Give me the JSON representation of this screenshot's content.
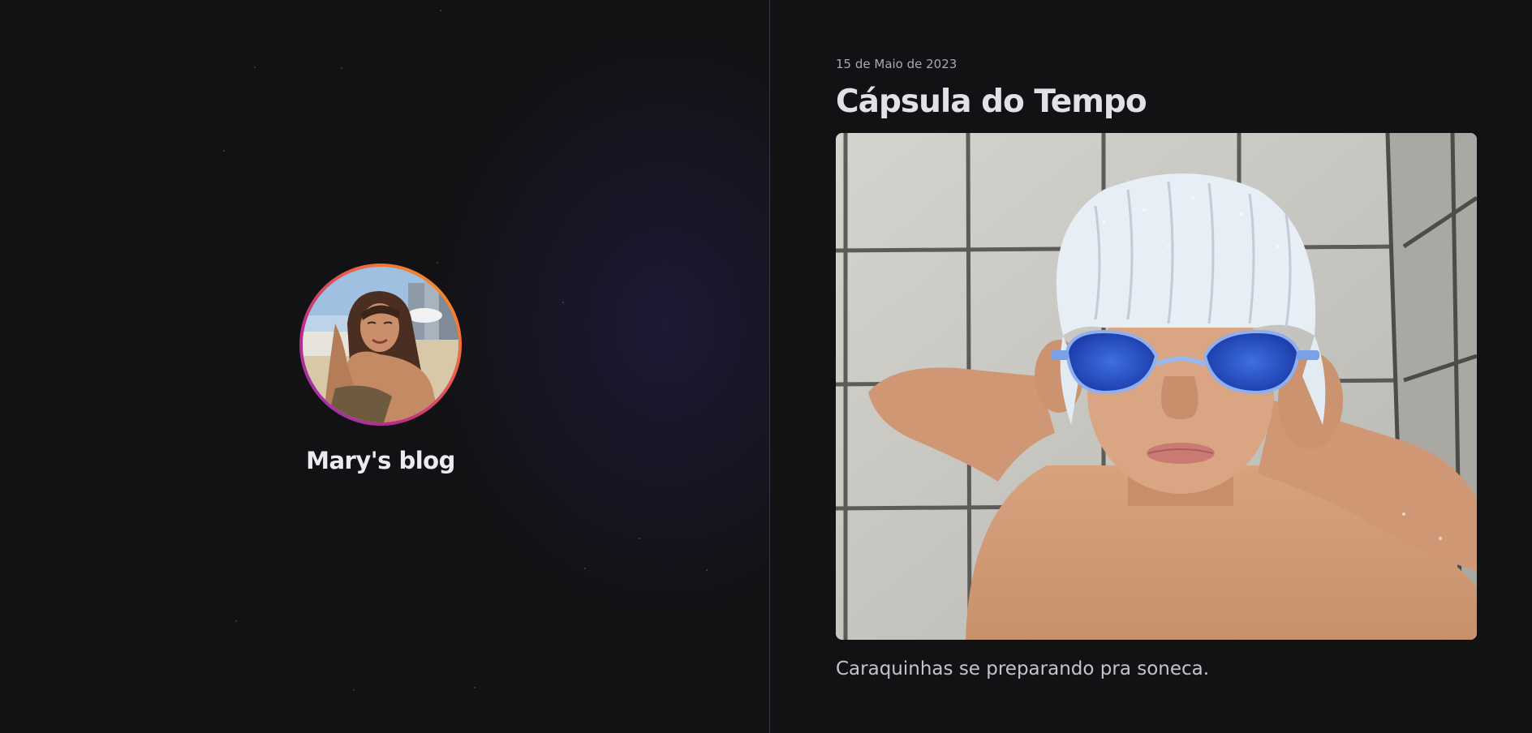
{
  "profile": {
    "blog_title": "Mary's blog",
    "avatar_alt": "profile photo",
    "ring_colors": [
      "#8a3ab9",
      "#bc2a8d",
      "#e95950",
      "#f58529",
      "#fccc63"
    ]
  },
  "post": {
    "date": "15 de Maio de 2023",
    "title": "Cápsula do Tempo",
    "caption": "Caraquinhas se preparando pra soneca."
  },
  "colors": {
    "background": "#121214",
    "divider": "#3a3a40",
    "title": "#e1e1e6",
    "muted": "#a8a8b3"
  }
}
